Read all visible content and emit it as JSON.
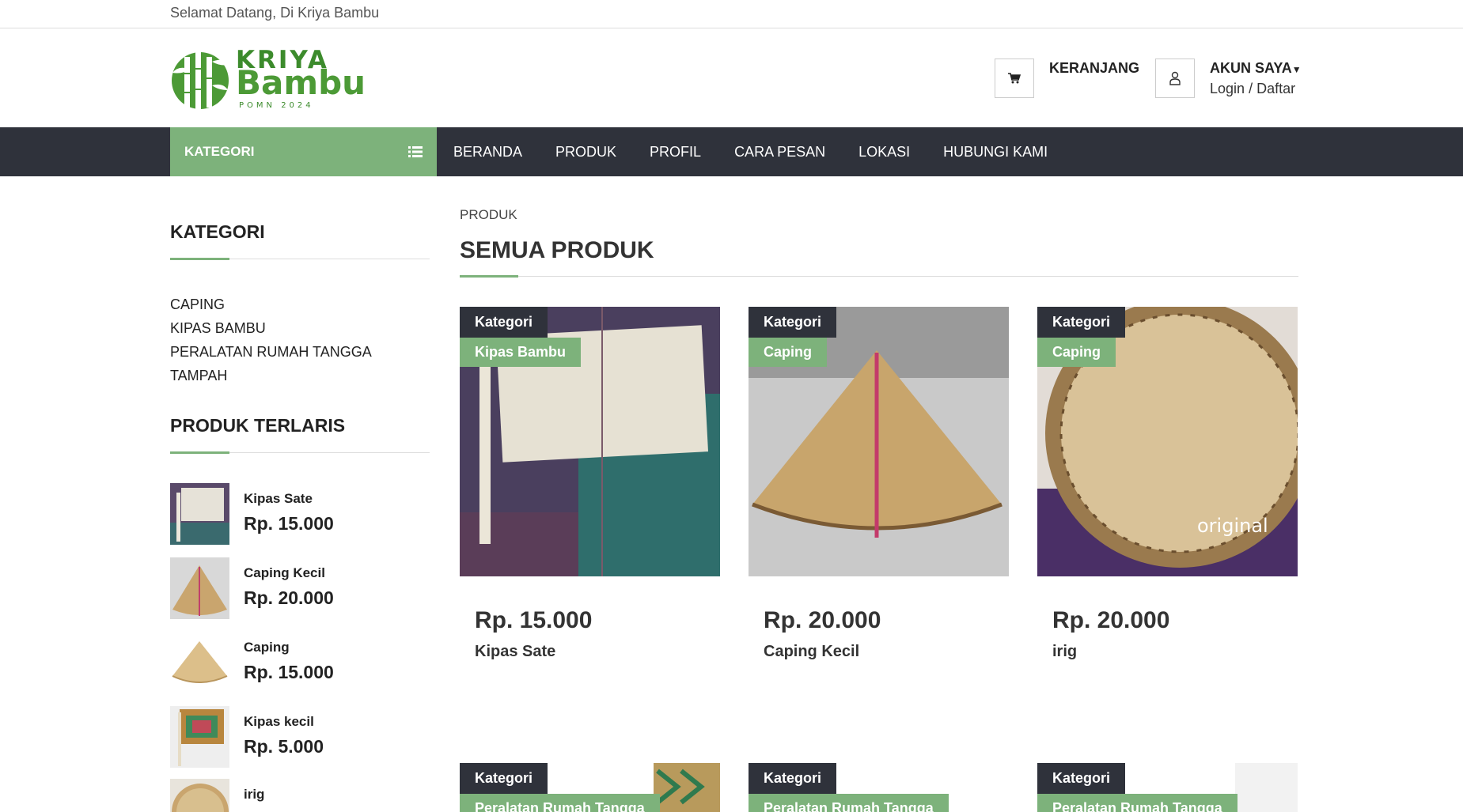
{
  "topbar": {
    "welcome": "Selamat Datang, Di Kriya Bambu"
  },
  "logo": {
    "line1": "KRIYA",
    "line2": "Bambu",
    "line3": "POMN 2024"
  },
  "header": {
    "cart_label": "KERANJANG",
    "account_label": "AKUN SAYA",
    "login_link": "Login",
    "separator": "/",
    "register_link": "Daftar"
  },
  "nav": {
    "category_button": "KATEGORI",
    "items": [
      "BERANDA",
      "PRODUK",
      "PROFIL",
      "CARA PESAN",
      "LOKASI",
      "HUBUNGI KAMI"
    ]
  },
  "sidebar": {
    "category_title": "KATEGORI",
    "categories": [
      "CAPING",
      "KIPAS BAMBU",
      "PERALATAN RUMAH TANGGA",
      "TAMPAH"
    ],
    "bestseller_title": "PRODUK TERLARIS",
    "bestsellers": [
      {
        "name": "Kipas Sate",
        "price": "Rp. 15.000"
      },
      {
        "name": "Caping Kecil",
        "price": "Rp. 20.000"
      },
      {
        "name": "Caping",
        "price": "Rp. 15.000"
      },
      {
        "name": "Kipas kecil",
        "price": "Rp. 5.000"
      },
      {
        "name": "irig",
        "price": ""
      }
    ]
  },
  "main": {
    "breadcrumb": "PRODUK",
    "title": "SEMUA PRODUK",
    "products": [
      {
        "tag": "Kategori",
        "category": "Kipas Bambu",
        "price": "Rp. 15.000",
        "name": "Kipas Sate"
      },
      {
        "tag": "Kategori",
        "category": "Caping",
        "price": "Rp. 20.000",
        "name": "Caping Kecil"
      },
      {
        "tag": "Kategori",
        "category": "Caping",
        "price": "Rp. 20.000",
        "name": "irig",
        "watermark": "original"
      },
      {
        "tag": "Kategori",
        "category": "Peralatan Rumah Tangga"
      },
      {
        "tag": "Kategori",
        "category": "Peralatan Rumah Tangga"
      },
      {
        "tag": "Kategori",
        "category": "Peralatan Rumah Tangga"
      }
    ]
  },
  "colors": {
    "accent": "#7db27b",
    "nav_bg": "#2f323b",
    "brand": "#4c9a36"
  }
}
